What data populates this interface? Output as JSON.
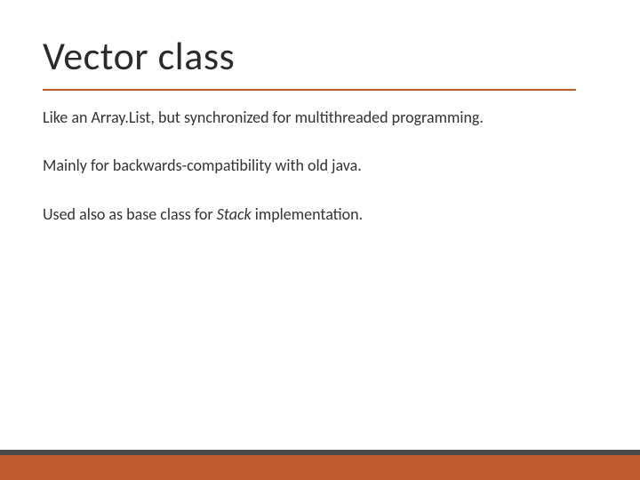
{
  "colors": {
    "accent": "#c05a2c",
    "stripe": "#4a4a4a",
    "text": "#2b2b2b"
  },
  "slide": {
    "title": "Vector class",
    "paragraphs": [
      {
        "plain": "Like an Array.List, but synchronized for multithreaded programming."
      },
      {
        "plain": "Mainly for backwards-compatibility with old java."
      },
      {
        "pre": "Used also as base class for ",
        "em": "Stack",
        "post": " implementation."
      }
    ]
  }
}
